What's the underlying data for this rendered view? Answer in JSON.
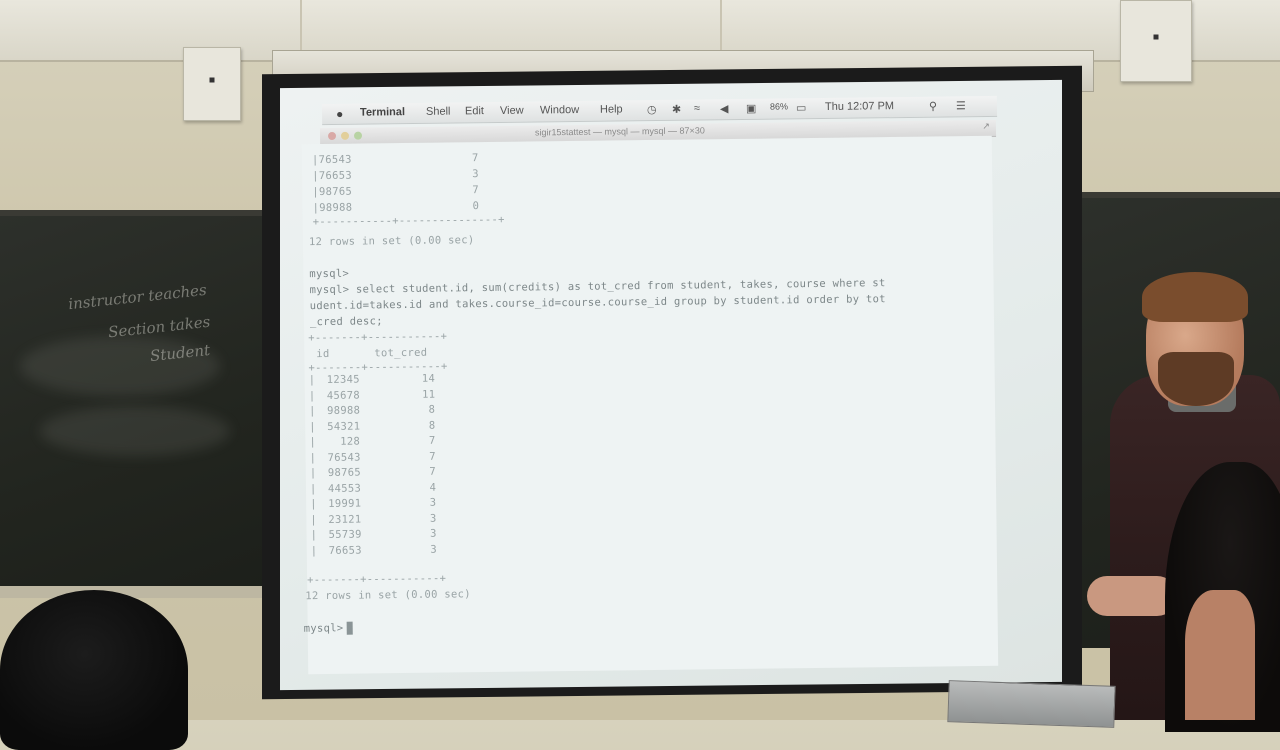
{
  "menubar": {
    "apple": "",
    "items": [
      "Terminal",
      "Shell",
      "Edit",
      "View",
      "Window",
      "Help"
    ],
    "battery": "86%",
    "clock": "Thu 12:07 PM"
  },
  "window": {
    "title": "sigir15stattest — mysql — mysql — 87×30"
  },
  "terminal": {
    "top_rows": [
      {
        "id": "76543",
        "val": "7"
      },
      {
        "id": "76653",
        "val": "3"
      },
      {
        "id": "98765",
        "val": "7"
      },
      {
        "id": "98988",
        "val": "0"
      }
    ],
    "rows_in_set_1": "12 rows in set (0.00 sec)",
    "prompt_empty": "mysql>",
    "query_line1": "mysql> select student.id, sum(credits) as tot_cred from student, takes, course where st",
    "query_line2": "udent.id=takes.id and takes.course_id=course.course_id group by student.id order by tot",
    "query_line3": "_cred desc;",
    "header_id": "id",
    "header_tot": "tot_cred",
    "result_rows": [
      {
        "id": "12345",
        "tot": "14"
      },
      {
        "id": "45678",
        "tot": "11"
      },
      {
        "id": "98988",
        "tot": "8"
      },
      {
        "id": "54321",
        "tot": "8"
      },
      {
        "id": "128",
        "tot": "7"
      },
      {
        "id": "76543",
        "tot": "7"
      },
      {
        "id": "98765",
        "tot": "7"
      },
      {
        "id": "44553",
        "tot": "4"
      },
      {
        "id": "19991",
        "tot": "3"
      },
      {
        "id": "23121",
        "tot": "3"
      },
      {
        "id": "55739",
        "tot": "3"
      },
      {
        "id": "76653",
        "tot": "3"
      }
    ],
    "rows_in_set_2": "12 rows in set (0.00 sec)",
    "prompt_final": "mysql>"
  },
  "chalkboard": {
    "line1": "instructor teaches",
    "line2": "Section takes",
    "line3": "Student"
  }
}
